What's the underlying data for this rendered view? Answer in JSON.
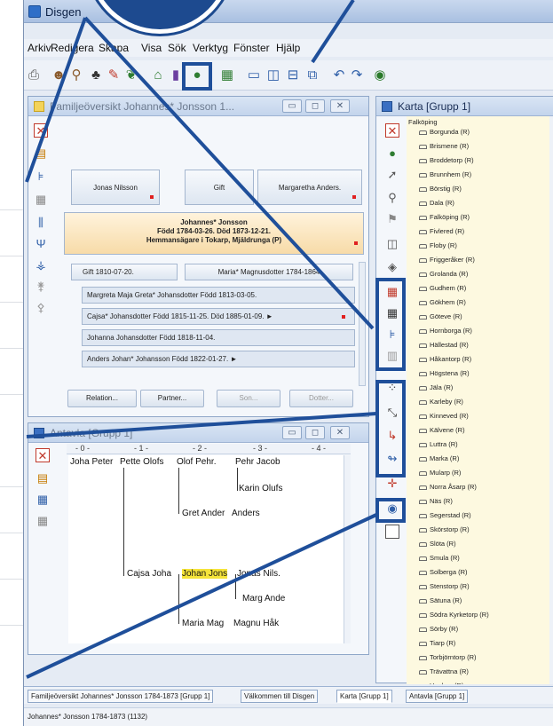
{
  "window": {
    "title": "Disgen"
  },
  "menu": {
    "items": [
      "Arkiv",
      "Redigera",
      "Skapa",
      "Visa",
      "Sök",
      "Verktyg",
      "Fönster",
      "Hjälp"
    ]
  },
  "family_panel": {
    "title": "Familjeöversikt Johannes* Jonsson 1...",
    "father": "Jonas Nilsson",
    "marriage": "Gift",
    "mother": "Margaretha Anders.",
    "main_person": {
      "line1": "Johannes* Jonsson",
      "line2": "Född 1784-03-26. Död 1873-12-21.",
      "line3": "Hemmansägare i Tokarp, Mjäldrunga (P)"
    },
    "marriage_date": "Gift 1810-07-20.",
    "spouse": "Maria* Magnusdotter 1784-1864",
    "children": [
      "Margreta Maja Greta* Johansdotter Född 1813-03-05.",
      "Cajsa* Johansdotter Född 1815-11-25. Död 1885-01-09. ►",
      "Johanna Johansdotter Född 1818-11-04.",
      "Anders Johan* Johansson Född 1822-01-27. ►"
    ],
    "buttons": {
      "relation": "Relation...",
      "partner": "Partner...",
      "son": "Son...",
      "dotter": "Dotter..."
    }
  },
  "antavla": {
    "title": "Antavla [Grupp 1]",
    "ruler": [
      "- 0 -",
      "- 1 -",
      "- 2 -",
      "- 3 -",
      "- 4 -"
    ],
    "nodes": {
      "johan_peter": "Joha Peter",
      "pette_olofs": "Pette Olofs",
      "olof_pehr": "Olof Pehr.",
      "pehr_jacob": "Pehr Jacob",
      "karin_olufs": "Karin Olufs",
      "gret_ander": "Gret Ander",
      "anders": "Anders",
      "cajsa_joha": "Cajsa Joha",
      "johan_jons": "Johan Jons",
      "jonas_nils": "Jonas Nils.",
      "marg_ande": "Marg Ande",
      "maria_mag": "Maria Mag",
      "magnu_hak": "Magnu Håk"
    }
  },
  "karta": {
    "title": "Karta [Grupp 1]",
    "root": "Falköping",
    "items": [
      "Borgunda (R)",
      "Brismene (R)",
      "Broddetorp (R)",
      "Brunnhem (R)",
      "Börstig (R)",
      "Dala (R)",
      "Falköping (R)",
      "Fivlered (R)",
      "Floby (R)",
      "Friggeråker (R)",
      "Grolanda (R)",
      "Gudhem (R)",
      "Gökhem (R)",
      "Göteve (R)",
      "Hornborga (R)",
      "Hällestad (R)",
      "Håkantorp (R)",
      "Högstena (R)",
      "Jäla (R)",
      "Karleby (R)",
      "Kinneved (R)",
      "Kälvene (R)",
      "Luttra (R)",
      "Marka (R)",
      "Mularp (R)",
      "Norra Åsarp (R)",
      "Näs (R)",
      "Segerstad (R)",
      "Skörstorp (R)",
      "Slöta (R)",
      "Smula (R)",
      "Solberga (R)",
      "Stenstorp (R)",
      "Sätuna (R)",
      "Södra Kyrketorp (R)",
      "Sörby (R)",
      "Tiarp (R)",
      "Torbjörntorp (R)",
      "Trävattna (R)",
      "Ugglum (R)"
    ]
  },
  "tabs": [
    "Familjeöversikt Johannes* Jonsson 1784-1873 [Grupp 1]",
    "Välkommen till Disgen",
    "Karta [Grupp 1]",
    "Antavla [Grupp 1]"
  ],
  "status": "Johannes* Jonsson 1784-1873 (1132)",
  "colors": {
    "accent": "#1f4f9a",
    "highlight": "#f5e43a",
    "person_main": "#fde9c4",
    "karta_bg": "#fdf9e0"
  }
}
